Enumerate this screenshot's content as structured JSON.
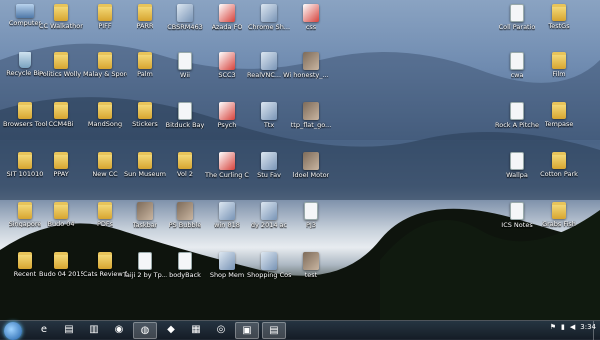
{
  "desktop": {
    "icons": [
      {
        "label": "Computer",
        "type": "pc"
      },
      {
        "label": "CC Walkathon",
        "type": "folder"
      },
      {
        "label": "PIFF",
        "type": "folder"
      },
      {
        "label": "PARR",
        "type": "folder"
      },
      {
        "label": "CBSRM463",
        "type": "app"
      },
      {
        "label": "Azada FO",
        "type": "red"
      },
      {
        "label": "Chrome Sh...",
        "type": "app"
      },
      {
        "label": "css",
        "type": "red"
      },
      {
        "label": "Recycle Bin",
        "type": "bin"
      },
      {
        "label": "Politics Wolly Goodie",
        "type": "folder"
      },
      {
        "label": "Malay & Spore",
        "type": "folder"
      },
      {
        "label": "Palm",
        "type": "folder"
      },
      {
        "label": "Wii",
        "type": "doc"
      },
      {
        "label": "SCC3",
        "type": "red"
      },
      {
        "label": "RealVNC... Windows ...",
        "type": "app"
      },
      {
        "label": "honesty_...",
        "type": "img"
      },
      {
        "label": "Browsers Tool",
        "type": "folder"
      },
      {
        "label": "CCM4Bi",
        "type": "folder"
      },
      {
        "label": "MandSong",
        "type": "folder"
      },
      {
        "label": "Stickers",
        "type": "folder"
      },
      {
        "label": "Bitduck Bay",
        "type": "doc"
      },
      {
        "label": "Psych",
        "type": "red"
      },
      {
        "label": "Ttx",
        "type": "app"
      },
      {
        "label": "ttp_flat_go...",
        "type": "img"
      },
      {
        "label": "SIT 101010",
        "type": "folder"
      },
      {
        "label": "PPAY",
        "type": "folder"
      },
      {
        "label": "New CC",
        "type": "folder"
      },
      {
        "label": "Sun Museum",
        "type": "folder"
      },
      {
        "label": "Vol 2",
        "type": "folder"
      },
      {
        "label": "The Curling Collapse of...",
        "type": "red"
      },
      {
        "label": "Stu Fav",
        "type": "app"
      },
      {
        "label": "ldoel Motor",
        "type": "img"
      },
      {
        "label": "Singapore",
        "type": "folder"
      },
      {
        "label": "Budo 04",
        "type": "folder"
      },
      {
        "label": "PDFs",
        "type": "folder"
      },
      {
        "label": "Taskbar",
        "type": "img"
      },
      {
        "label": "PS Bubble",
        "type": "img"
      },
      {
        "label": "win 818",
        "type": "app"
      },
      {
        "label": "dy 2014 ac",
        "type": "app"
      },
      {
        "label": "PJ3",
        "type": "doc"
      },
      {
        "label": "Recent",
        "type": "folder"
      },
      {
        "label": "Budo 04 2015",
        "type": "folder"
      },
      {
        "label": "Cats Review Desc",
        "type": "folder"
      },
      {
        "label": "Taiji 2 by Tp...",
        "type": "doc"
      },
      {
        "label": "bodyBack",
        "type": "doc"
      },
      {
        "label": "Shop Mem",
        "type": "app"
      },
      {
        "label": "Shopping Cost",
        "type": "app"
      },
      {
        "label": "test",
        "type": "img"
      },
      {
        "label": "Coll Paratio",
        "type": "doc"
      },
      {
        "label": "TestGs",
        "type": "folder"
      },
      {
        "label": "cwa",
        "type": "doc"
      },
      {
        "label": "Film",
        "type": "folder"
      },
      {
        "label": "Rock A Pitched",
        "type": "doc"
      },
      {
        "label": "Tempase",
        "type": "folder"
      },
      {
        "label": "Wallpa",
        "type": "doc"
      },
      {
        "label": "Cotton Park",
        "type": "folder"
      },
      {
        "label": "ICS Notes",
        "type": "doc"
      },
      {
        "label": "Grabs Fish",
        "type": "folder"
      }
    ]
  },
  "taskbar": {
    "items": [
      {
        "name": "ie-icon",
        "glyph": "e",
        "active": false
      },
      {
        "name": "explorer-icon",
        "glyph": "▤",
        "active": false
      },
      {
        "name": "folder-icon",
        "glyph": "▥",
        "active": false
      },
      {
        "name": "chrome-icon",
        "glyph": "◉",
        "active": false
      },
      {
        "name": "firefox-icon",
        "glyph": "◍",
        "active": true
      },
      {
        "name": "pin-icon",
        "glyph": "◆",
        "active": false
      },
      {
        "name": "apps-icon",
        "glyph": "▦",
        "active": false
      },
      {
        "name": "browser-icon",
        "glyph": "◎",
        "active": false
      },
      {
        "name": "window-icon",
        "glyph": "▣",
        "active": true
      },
      {
        "name": "doc-icon",
        "glyph": "▤",
        "active": true
      }
    ],
    "tray": {
      "clock": "3:34"
    }
  }
}
